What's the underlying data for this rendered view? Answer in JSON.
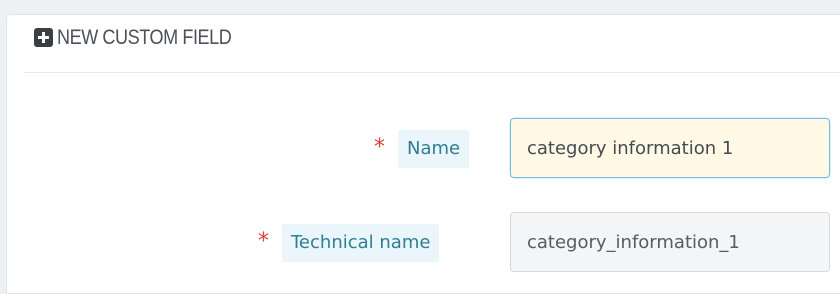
{
  "panel": {
    "title": "NEW CUSTOM FIELD",
    "header_icon": "plus-square-icon"
  },
  "fields": {
    "name": {
      "required_mark": "*",
      "label": "Name",
      "value": "category information 1"
    },
    "technical_name": {
      "required_mark": "*",
      "label": "Technical name",
      "value": "category_information_1"
    }
  },
  "colors": {
    "required": "#e0403a",
    "label_text": "#2f7e92",
    "label_bg": "#eaf6fb",
    "active_input_bg": "#fff9e5",
    "active_input_border": "#72c2d8",
    "readonly_input_bg": "#f3f5f6"
  }
}
